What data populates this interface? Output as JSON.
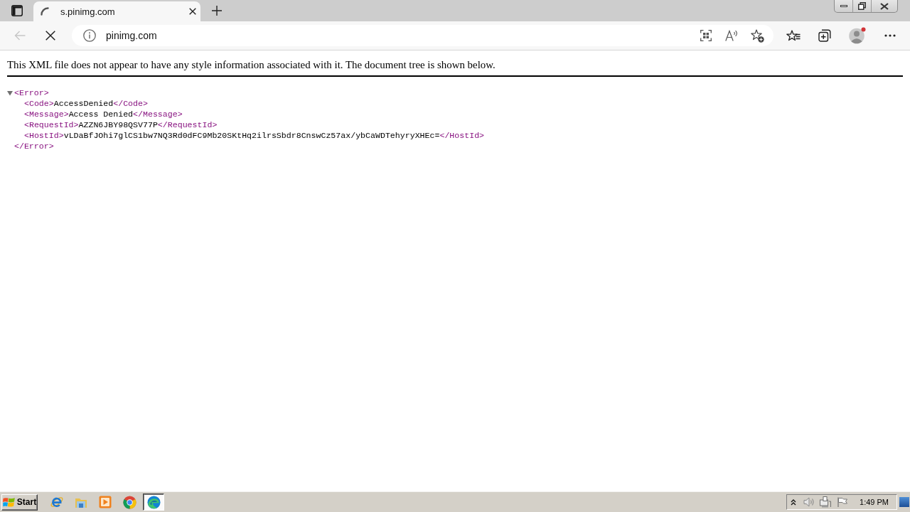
{
  "browser": {
    "tabs": [
      {
        "title": "s.pinimg.com",
        "selected": true,
        "loading": true
      }
    ],
    "back_button": {
      "disabled": true
    },
    "address_bar": {
      "url": "pinimg.com"
    }
  },
  "page": {
    "notice": "This XML file does not appear to have any style information associated with it. The document tree is shown below.",
    "xml_tree": {
      "open_tag": "<Error>",
      "expanded": true,
      "close_tag": "</Error>",
      "children": [
        {
          "open_tag": "<Code>",
          "value": "AccessDenied",
          "close_tag": "</Code>"
        },
        {
          "open_tag": "<Message>",
          "value": "Access Denied",
          "close_tag": "</Message>"
        },
        {
          "open_tag": "<RequestId>",
          "value": "AZZN6JBY98QSV77P",
          "close_tag": "</RequestId>"
        },
        {
          "open_tag": "<HostId>",
          "value": "vLDaBfJOhi7glCS1bw7NQ3Rd0dFC9Mb20SKtHq2ilrsSbdr8CnswCz57ax/ybCaWDTehyryXHEc=",
          "close_tag": "</HostId>"
        }
      ]
    }
  },
  "taskbar": {
    "start_label": "Start",
    "apps": [
      {
        "kind": "ie",
        "selected": false
      },
      {
        "kind": "explorer",
        "selected": false
      },
      {
        "kind": "media",
        "selected": false
      },
      {
        "kind": "chrome",
        "selected": false
      },
      {
        "kind": "edge",
        "selected": true
      }
    ],
    "clock": "1:49 PM"
  }
}
